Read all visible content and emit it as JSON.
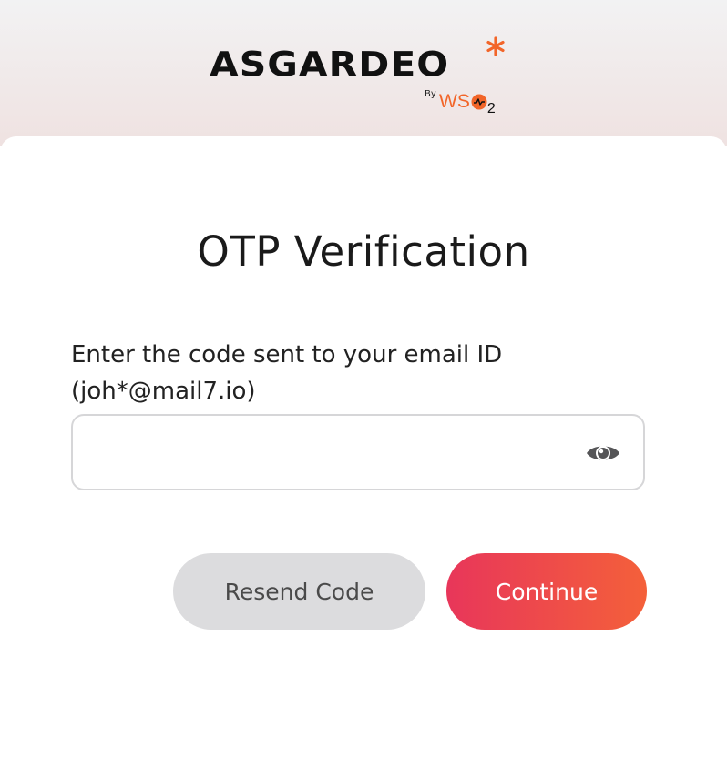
{
  "logo": {
    "brand": "ASGARDEO",
    "by": "By",
    "org_prefix": "WS",
    "org_suffix": "2",
    "star_color": "#f26529",
    "org_color": "#f26529"
  },
  "page": {
    "title": "OTP Verification",
    "prompt_line1": "Enter the code sent to your email ID",
    "prompt_line2": "(joh*@mail7.io)"
  },
  "otp_field": {
    "value": "",
    "placeholder": "",
    "toggle_icon": "eye-icon"
  },
  "actions": {
    "resend_label": "Resend Code",
    "continue_label": "Continue"
  },
  "colors": {
    "accent_start": "#e8365a",
    "accent_end": "#f4603a",
    "secondary_button": "#dcdcde"
  }
}
